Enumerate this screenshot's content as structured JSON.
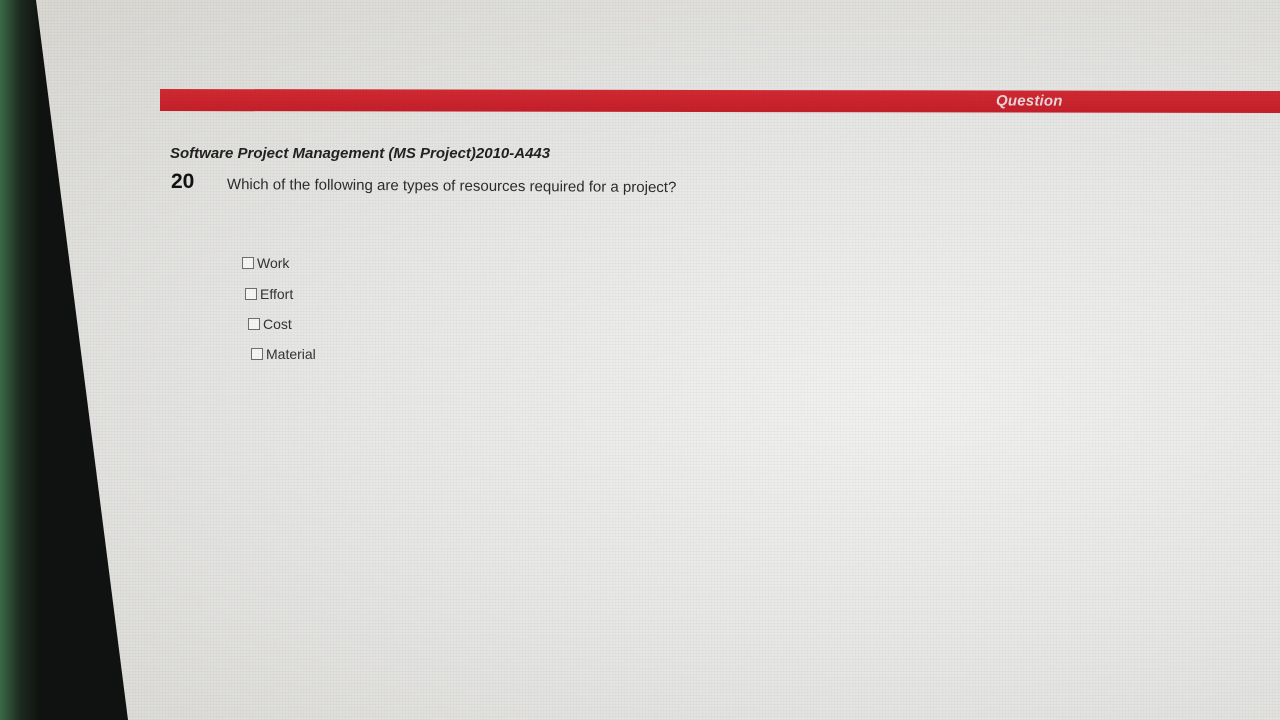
{
  "header": {
    "bar_label": "Question",
    "bar_color": "#cc2530"
  },
  "question": {
    "course_title": "Software Project Management (MS Project)2010-A443",
    "number": "20",
    "text": "Which of the following are types of resources required for a project?",
    "options": [
      {
        "label": "Work",
        "checked": false
      },
      {
        "label": "Effort",
        "checked": false
      },
      {
        "label": "Cost",
        "checked": false
      },
      {
        "label": "Material",
        "checked": false
      }
    ]
  }
}
